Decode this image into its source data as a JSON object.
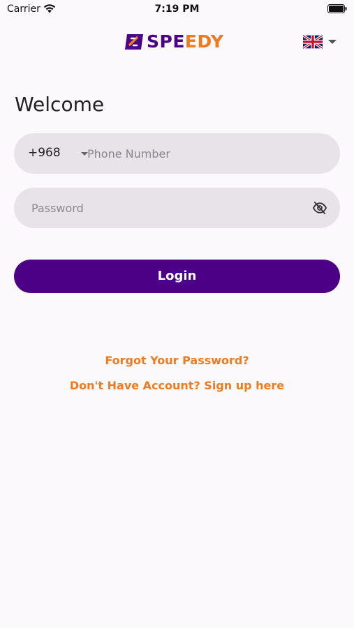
{
  "status_bar": {
    "carrier": "Carrier",
    "time": "7:19 PM"
  },
  "header": {
    "logo_part1": "SPE",
    "logo_part2": "EDY",
    "language_flag_icon": "uk-flag-icon"
  },
  "login": {
    "welcome": "Welcome",
    "country_code": "+968",
    "phone_placeholder": "Phone Number",
    "password_placeholder": "Password",
    "login_label": "Login",
    "forgot_password": "Forgot Your Password?",
    "signup": "Don't Have Account? Sign up here"
  },
  "colors": {
    "brand_purple": "#4b0085",
    "brand_orange": "#f07a1e",
    "field_bg": "#e8e2e9",
    "page_bg": "#fcf9fd"
  }
}
